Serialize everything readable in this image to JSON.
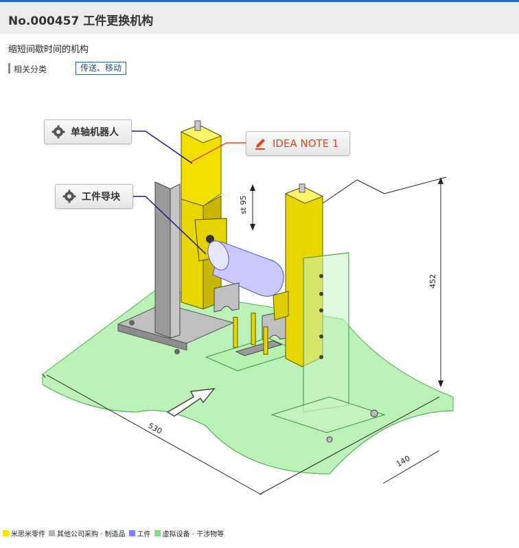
{
  "header": {
    "title": "No.000457 工件更换机构"
  },
  "subtitle": "缩短间歇时间的机构",
  "category": {
    "label": "相关分类",
    "tag": "传送、移动"
  },
  "callouts": {
    "robot": "单轴机器人",
    "guide": "工件导块",
    "idea": "IDEA NOTE 1"
  },
  "dimensions": {
    "stroke": "st 95",
    "height": "452",
    "length": "530",
    "depth": "140"
  },
  "legend": [
    {
      "label": "米思米零件",
      "color": "#f5e600"
    },
    {
      "label": "其他公司采购 · 制造品",
      "color": "#b5b5b5"
    },
    {
      "label": "工件",
      "color": "#8080ff"
    },
    {
      "label": "虚拟设备 · 干涉物等",
      "color": "#7ee07e"
    }
  ]
}
